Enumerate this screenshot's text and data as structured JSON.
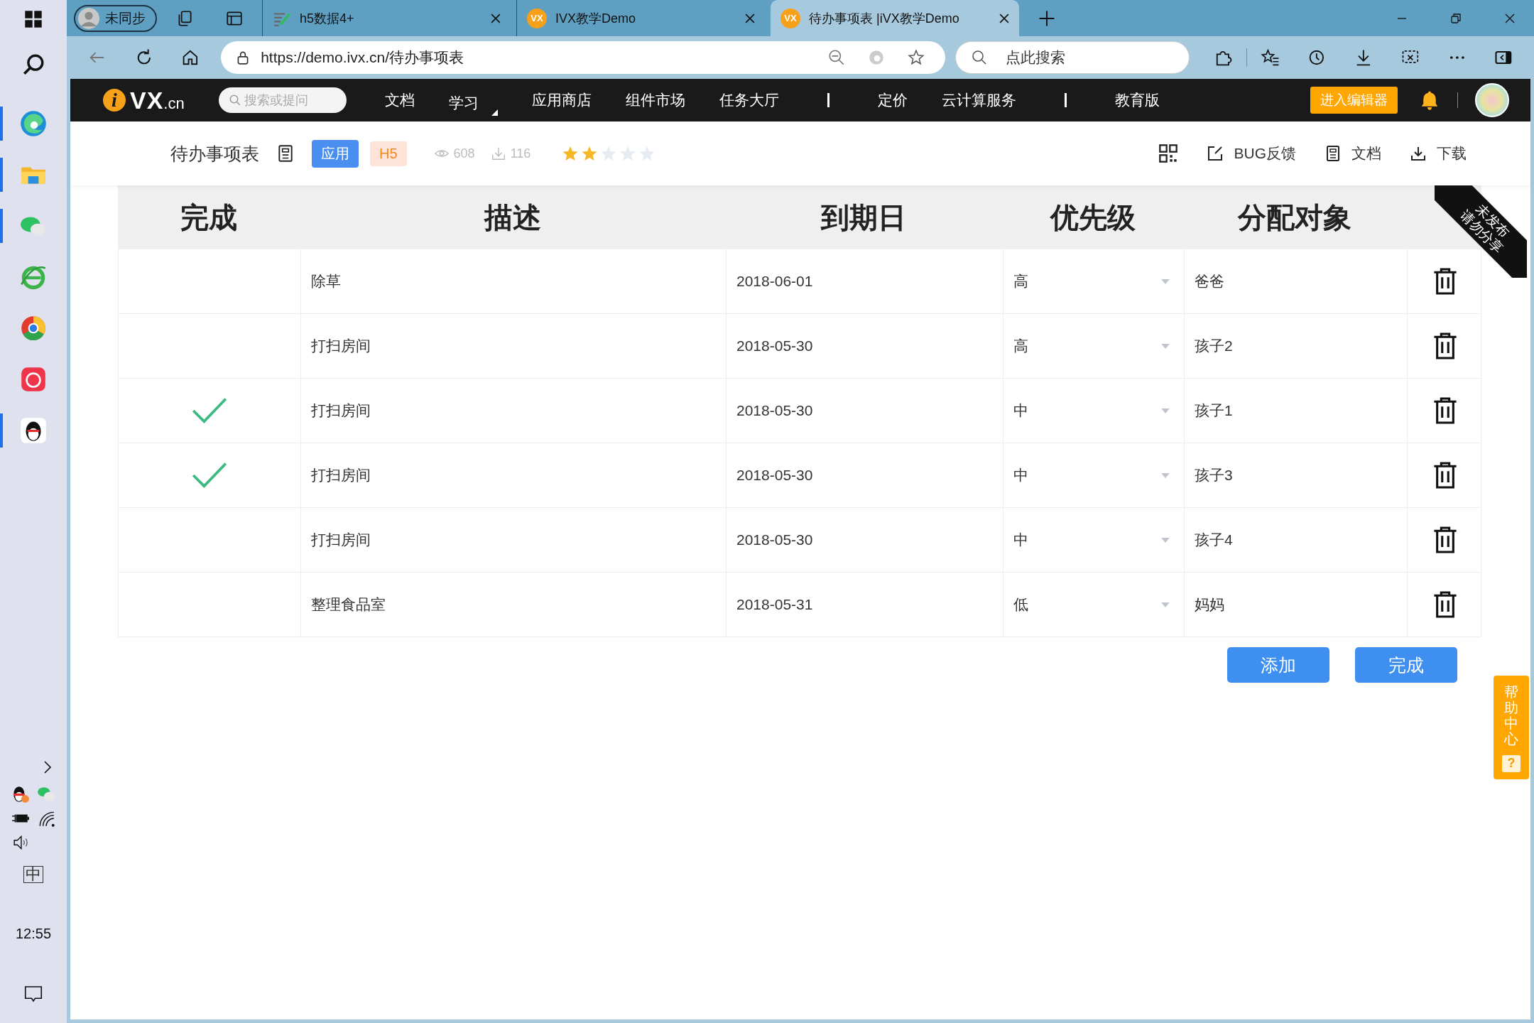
{
  "taskbar": {
    "apps": [
      {
        "kind": "browser",
        "running": true
      },
      {
        "kind": "folder",
        "running": true
      },
      {
        "kind": "chat",
        "running": true
      },
      {
        "kind": "globe",
        "running": false
      },
      {
        "kind": "wheel",
        "running": false
      },
      {
        "kind": "app",
        "running": false
      },
      {
        "kind": "penguin",
        "running": true
      }
    ],
    "ime": "中",
    "clock": "12:55"
  },
  "browser": {
    "profile": "未同步",
    "tabs": [
      {
        "title": "h5数据4+",
        "selected": false
      },
      {
        "title": "IVX教学Demo",
        "favicon": "VX",
        "selected": false
      },
      {
        "title": "待办事项表 |iVX教学Demo",
        "favicon": "VX",
        "selected": true
      }
    ],
    "address": "https://demo.ivx.cn/待办事项表",
    "search": {
      "placeholder": "点此搜索"
    }
  },
  "nav": {
    "logo": {
      "mark": "i",
      "name": "VX",
      "suffix": ".cn"
    },
    "search": {
      "placeholder": "搜索或提问"
    },
    "items": [
      {
        "kind": "link",
        "label": "文档"
      },
      {
        "kind": "menu",
        "label": "学习"
      },
      {
        "kind": "link",
        "label": "应用商店"
      },
      {
        "kind": "link",
        "label": "组件市场"
      },
      {
        "kind": "link",
        "label": "任务大厅"
      },
      {
        "kind": "divider"
      },
      {
        "kind": "link",
        "label": "定价"
      },
      {
        "kind": "link",
        "label": "云计算服务"
      },
      {
        "kind": "divider"
      },
      {
        "kind": "link",
        "label": "教育版"
      }
    ],
    "editor_button": "进入编辑器"
  },
  "app": {
    "title": "待办事项表",
    "tags": [
      "应用",
      "H5"
    ],
    "views": "608",
    "downloads": "116",
    "stars": 2,
    "actions": [
      "BUG反馈",
      "文档",
      "下载"
    ]
  },
  "ribbon": [
    "未发布",
    "请勿分享"
  ],
  "table": {
    "columns": [
      "完成",
      "描述",
      "到期日",
      "优先级",
      "分配对象"
    ],
    "rows": [
      {
        "done": false,
        "description": "除草",
        "due": "2018-06-01",
        "priority": "高",
        "assignee": "爸爸"
      },
      {
        "done": false,
        "description": "打扫房间",
        "due": "2018-05-30",
        "priority": "高",
        "assignee": "孩子2"
      },
      {
        "done": true,
        "description": "打扫房间",
        "due": "2018-05-30",
        "priority": "中",
        "assignee": "孩子1"
      },
      {
        "done": true,
        "description": "打扫房间",
        "due": "2018-05-30",
        "priority": "中",
        "assignee": "孩子3"
      },
      {
        "done": false,
        "description": "打扫房间",
        "due": "2018-05-30",
        "priority": "中",
        "assignee": "孩子4"
      },
      {
        "done": false,
        "description": "整理食品室",
        "due": "2018-05-31",
        "priority": "低",
        "assignee": "妈妈"
      }
    ]
  },
  "buttons": [
    "添加",
    "完成"
  ],
  "help": {
    "label": "帮助中心",
    "icon": "?"
  }
}
